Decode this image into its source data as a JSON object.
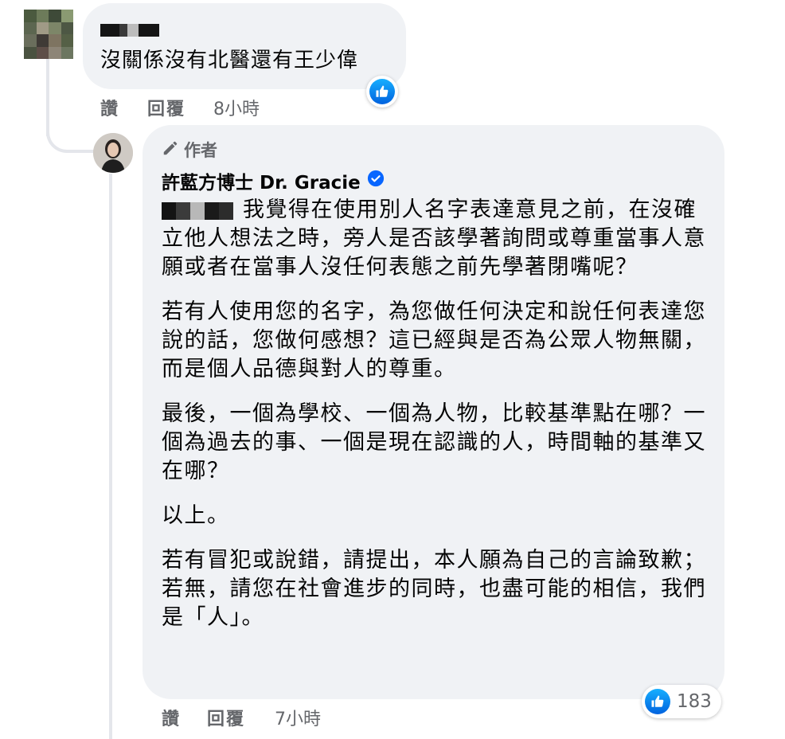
{
  "comment1": {
    "text": "沒關係沒有北醫還有王少偉",
    "actions": {
      "like": "讚",
      "reply": "回覆",
      "time": "8小時"
    }
  },
  "comment2": {
    "author_badge": "作者",
    "author_name": "許藍方博士 Dr. Gracie",
    "paragraphs": [
      "我覺得在使用別人名字表達意見之前，在沒確立他人想法之時，旁人是否該學著詢問或尊重當事人意願或者在當事人沒任何表態之前先學著閉嘴呢？",
      "若有人使用您的名字，為您做任何決定和說任何表達您說的話，您做何感想？這已經與是否為公眾人物無關，而是個人品德與對人的尊重。",
      "最後，一個為學校、一個為人物，比較基準點在哪？一個為過去的事、一個是現在認識的人，時間軸的基準又在哪？",
      "以上。",
      "若有冒犯或說錯，請提出，本人願為自己的言論致歉；若無，請您在社會進步的同時，也盡可能的相信，我們是「人」。"
    ],
    "reaction_count": "183",
    "actions": {
      "like": "讚",
      "reply": "回覆",
      "time": "7小時"
    }
  },
  "icons": {
    "like": "like-thumb-icon",
    "verified": "verified-badge-icon",
    "author": "pencil-icon"
  },
  "colors": {
    "bubble": "#f0f2f5",
    "meta": "#65676b",
    "like_blue": "#0866ff"
  }
}
